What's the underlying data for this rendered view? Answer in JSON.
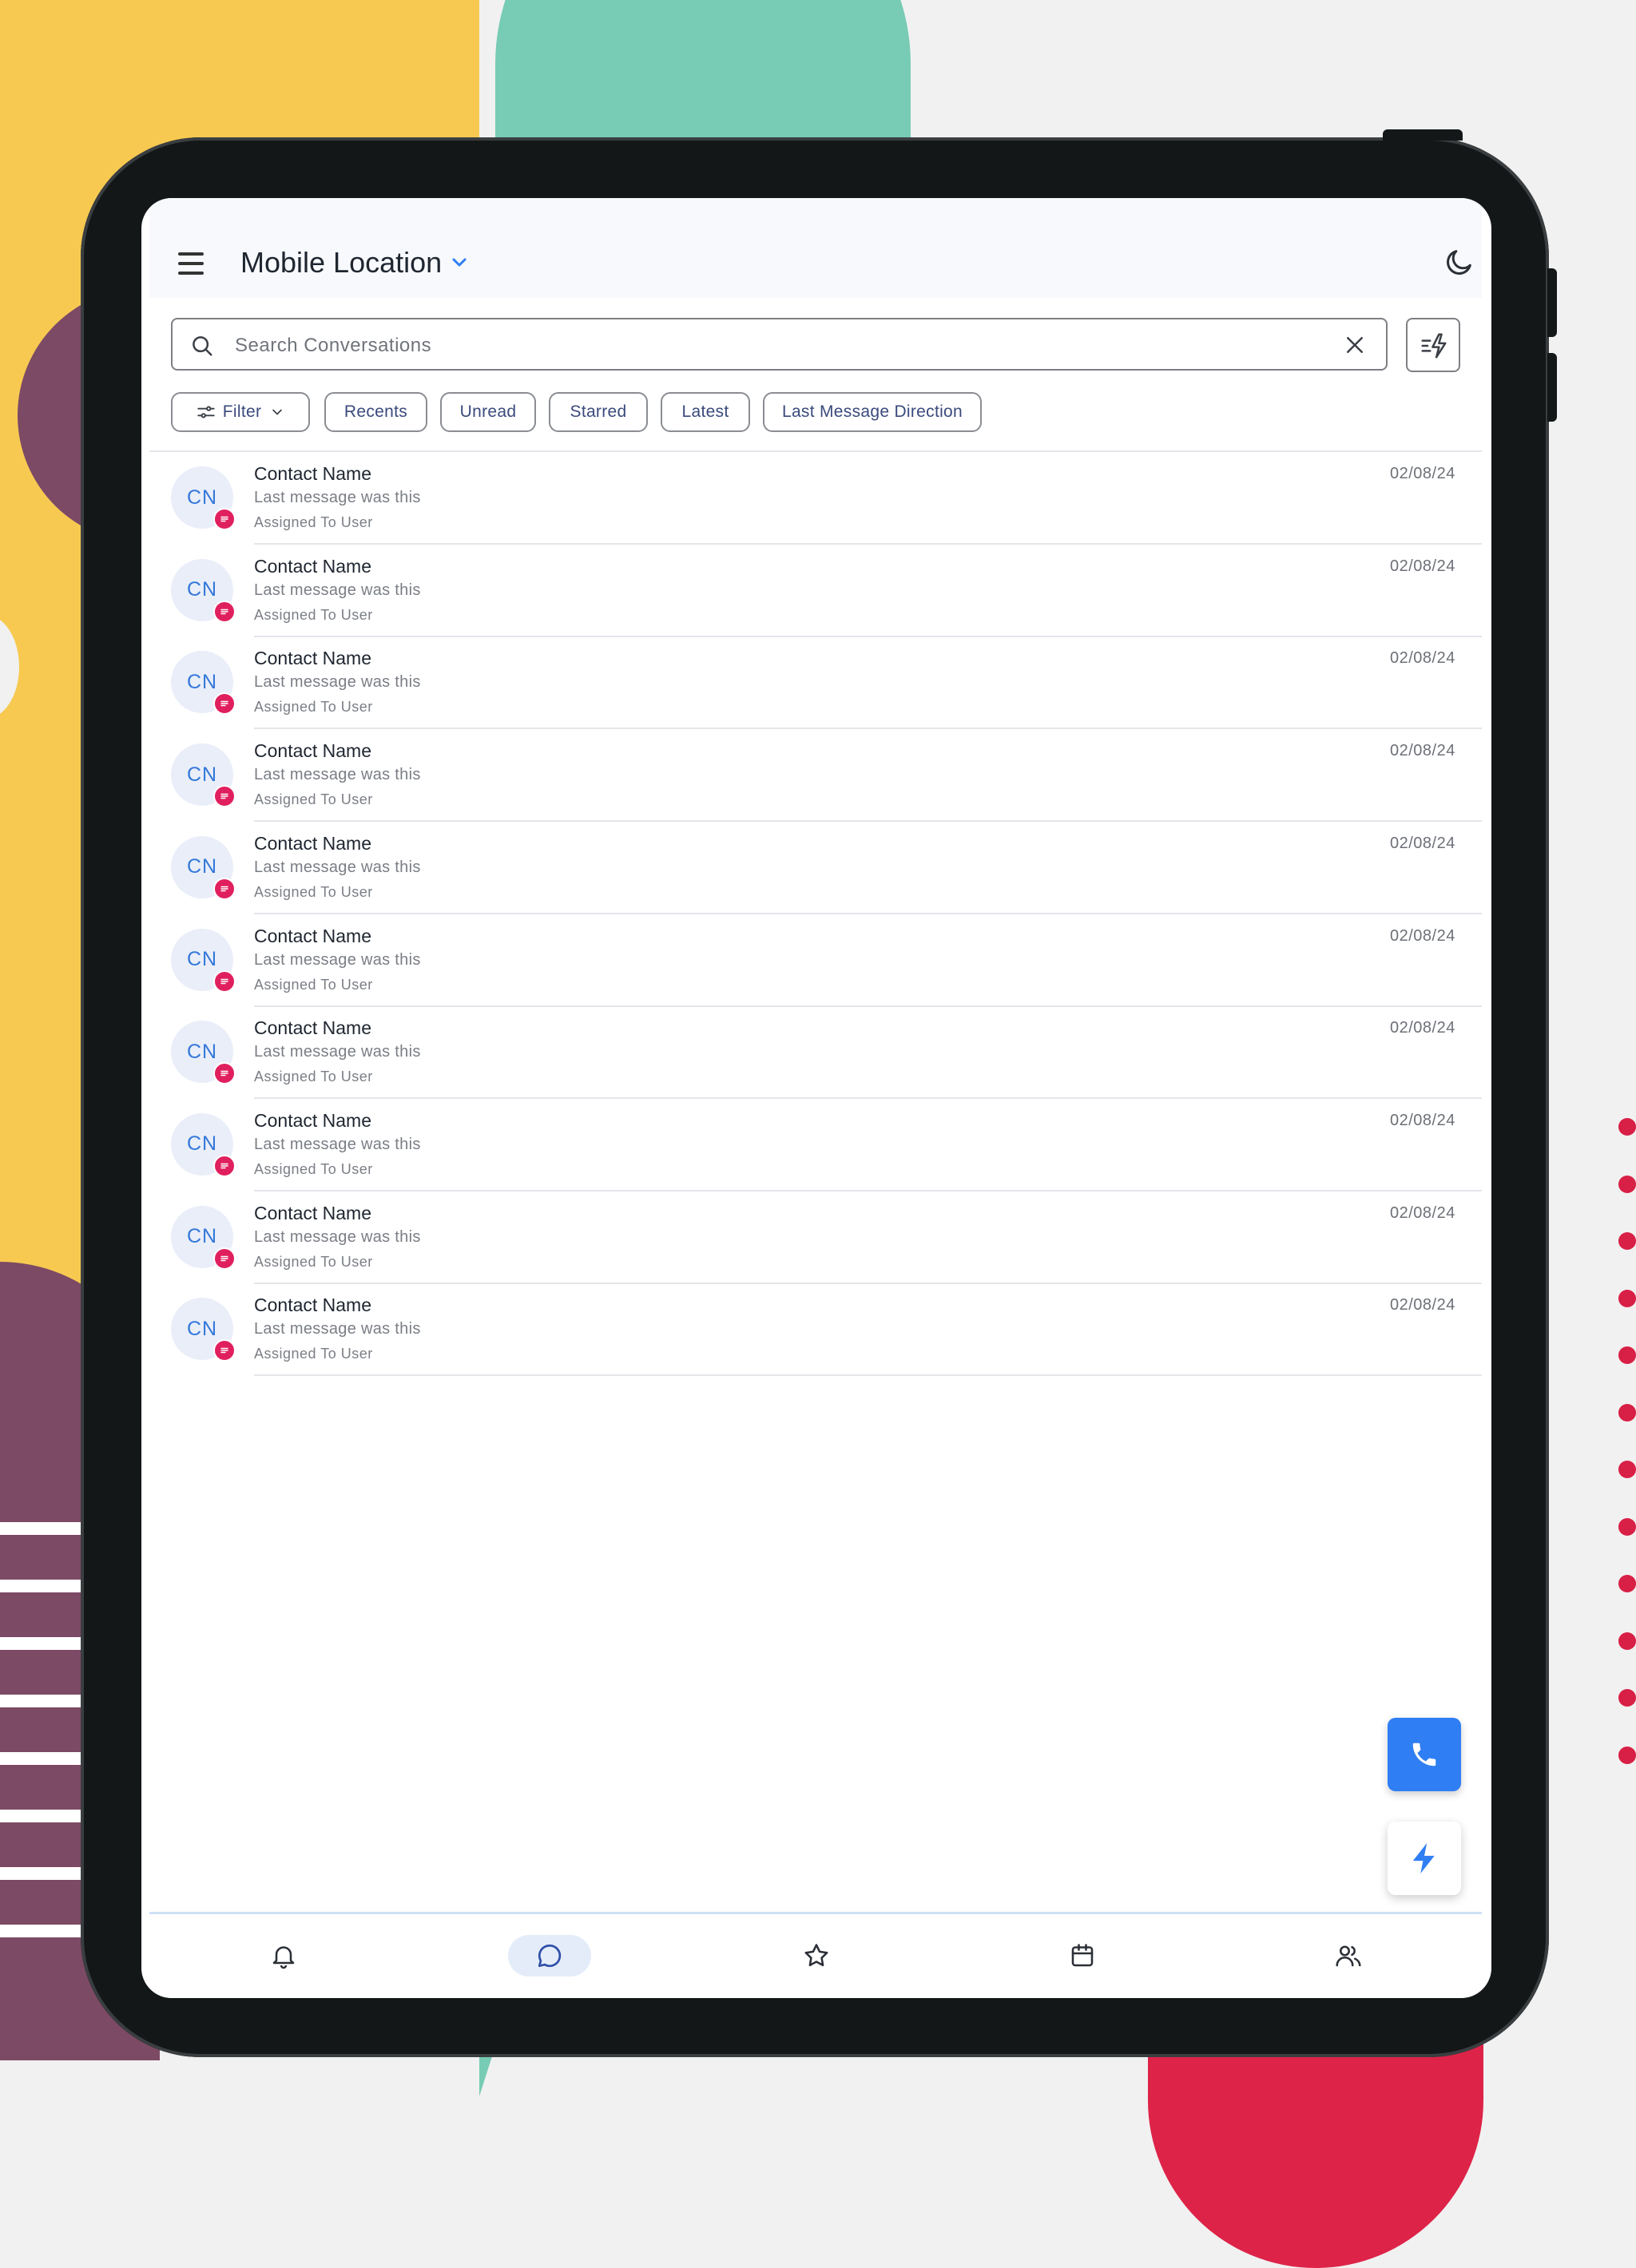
{
  "header": {
    "title": "Mobile Location"
  },
  "search": {
    "placeholder": "Search Conversations"
  },
  "filters": {
    "filter_label": "Filter",
    "chips": [
      "Recents",
      "Unread",
      "Starred",
      "Latest",
      "Last Message Direction"
    ]
  },
  "conversations": [
    {
      "initials": "CN",
      "name": "Contact Name",
      "message": "Last message was this",
      "assigned": "Assigned To User",
      "date": "02/08/24"
    },
    {
      "initials": "CN",
      "name": "Contact Name",
      "message": "Last message was this",
      "assigned": "Assigned To User",
      "date": "02/08/24"
    },
    {
      "initials": "CN",
      "name": "Contact Name",
      "message": "Last message was this",
      "assigned": "Assigned To User",
      "date": "02/08/24"
    },
    {
      "initials": "CN",
      "name": "Contact Name",
      "message": "Last message was this",
      "assigned": "Assigned To User",
      "date": "02/08/24"
    },
    {
      "initials": "CN",
      "name": "Contact Name",
      "message": "Last message was this",
      "assigned": "Assigned To User",
      "date": "02/08/24"
    },
    {
      "initials": "CN",
      "name": "Contact Name",
      "message": "Last message was this",
      "assigned": "Assigned To User",
      "date": "02/08/24"
    },
    {
      "initials": "CN",
      "name": "Contact Name",
      "message": "Last message was this",
      "assigned": "Assigned To User",
      "date": "02/08/24"
    },
    {
      "initials": "CN",
      "name": "Contact Name",
      "message": "Last message was this",
      "assigned": "Assigned To User",
      "date": "02/08/24"
    },
    {
      "initials": "CN",
      "name": "Contact Name",
      "message": "Last message was this",
      "assigned": "Assigned To User",
      "date": "02/08/24"
    },
    {
      "initials": "CN",
      "name": "Contact Name",
      "message": "Last message was this",
      "assigned": "Assigned To User",
      "date": "02/08/24"
    }
  ],
  "nav": {
    "items": [
      {
        "icon": "bell-icon",
        "active": false
      },
      {
        "icon": "chat-icon",
        "active": true
      },
      {
        "icon": "star-icon",
        "active": false
      },
      {
        "icon": "calendar-icon",
        "active": false
      },
      {
        "icon": "users-icon",
        "active": false
      }
    ]
  },
  "colors": {
    "accent": "#2f7ef3",
    "badge": "#e0205e",
    "avatar_bg": "#e9eef9",
    "avatar_text": "#3478d9",
    "chip_text": "#3a4a7c"
  },
  "icons": {
    "menu": "menu-icon",
    "dropdown": "chevron-down-icon",
    "theme": "moon-icon",
    "search": "search-icon",
    "clear": "close-icon",
    "quick_actions": "bolt-list-icon",
    "channel_badge": "message-icon",
    "call": "phone-icon",
    "bolt": "bolt-icon"
  }
}
